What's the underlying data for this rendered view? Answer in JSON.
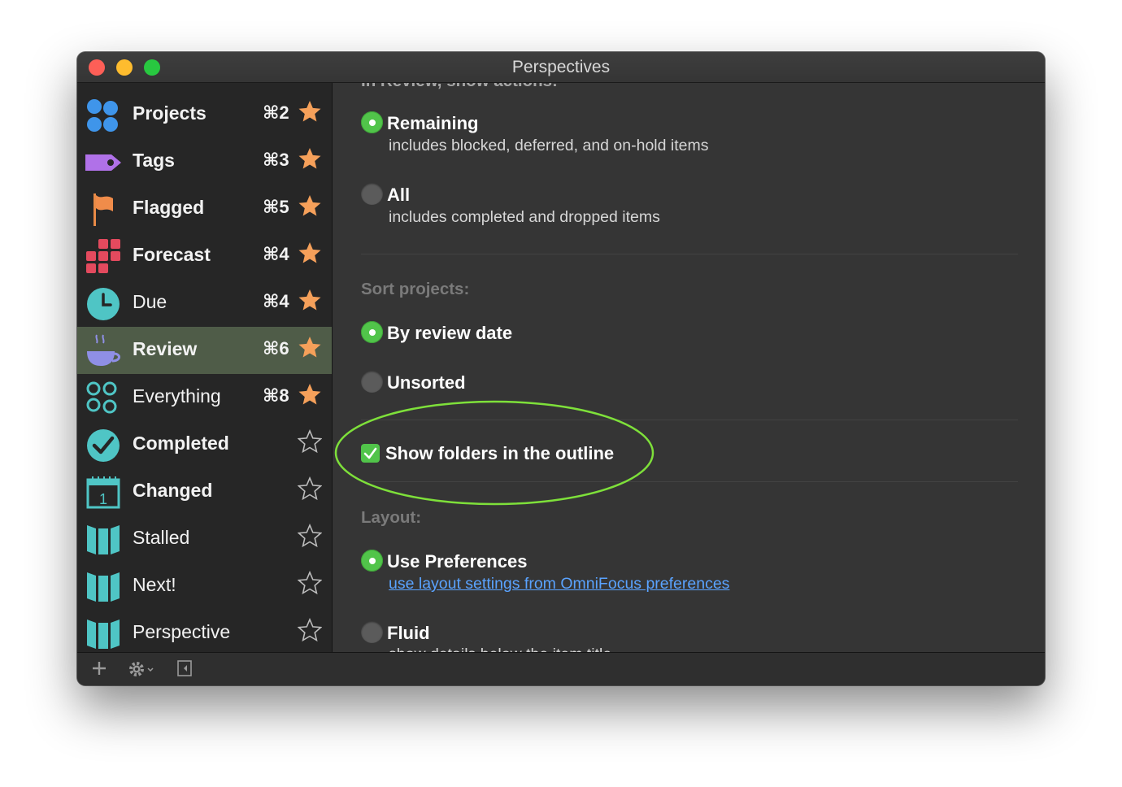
{
  "window": {
    "title": "Perspectives"
  },
  "sidebar": {
    "items": [
      {
        "label": "Projects",
        "shortcut": "⌘2",
        "favorite": true,
        "icon": "projects-dots-icon",
        "bold": true
      },
      {
        "label": "Tags",
        "shortcut": "⌘3",
        "favorite": true,
        "icon": "tag-icon",
        "bold": true
      },
      {
        "label": "Flagged",
        "shortcut": "⌘5",
        "favorite": true,
        "icon": "flag-icon",
        "bold": true
      },
      {
        "label": "Forecast",
        "shortcut": "⌘4",
        "favorite": true,
        "icon": "forecast-grid-icon",
        "bold": true
      },
      {
        "label": "Due",
        "shortcut": "⌘4",
        "favorite": true,
        "icon": "clock-icon",
        "bold": false
      },
      {
        "label": "Review",
        "shortcut": "⌘6",
        "favorite": true,
        "icon": "coffee-cup-icon",
        "bold": true,
        "selected": true
      },
      {
        "label": "Everything",
        "shortcut": "⌘8",
        "favorite": true,
        "icon": "everything-circles-icon",
        "bold": false
      },
      {
        "label": "Completed",
        "shortcut": "",
        "favorite": false,
        "icon": "checkmark-circle-icon",
        "bold": true
      },
      {
        "label": "Changed",
        "shortcut": "",
        "favorite": false,
        "icon": "calendar-icon",
        "bold": true
      },
      {
        "label": "Stalled",
        "shortcut": "",
        "favorite": false,
        "icon": "perspective-book-icon",
        "bold": false
      },
      {
        "label": "Next!",
        "shortcut": "",
        "favorite": false,
        "icon": "perspective-book-icon",
        "bold": false
      },
      {
        "label": "Perspective",
        "shortcut": "",
        "favorite": false,
        "icon": "perspective-book-icon",
        "bold": false
      }
    ]
  },
  "main": {
    "review_show_header": "In Review, show actions:",
    "review_options": [
      {
        "label": "Remaining",
        "desc": "includes blocked, deferred, and on-hold items",
        "selected": true
      },
      {
        "label": "All",
        "desc": "includes completed and dropped items",
        "selected": false
      }
    ],
    "sort_header": "Sort projects:",
    "sort_options": [
      {
        "label": "By review date",
        "selected": true
      },
      {
        "label": "Unsorted",
        "selected": false
      }
    ],
    "show_folders": {
      "label": "Show folders in the outline",
      "checked": true
    },
    "layout_header": "Layout:",
    "layout_options": [
      {
        "label": "Use Preferences",
        "link": "use layout settings from OmniFocus preferences",
        "selected": true
      },
      {
        "label": "Fluid",
        "desc": "show details below the item title",
        "selected": false
      }
    ]
  },
  "colors": {
    "selected_row": "#4f5c48",
    "radio_on": "#51c44a",
    "star_filled": "#f5a05a",
    "annotation": "#7ee03a",
    "link": "#5aa3ff"
  }
}
